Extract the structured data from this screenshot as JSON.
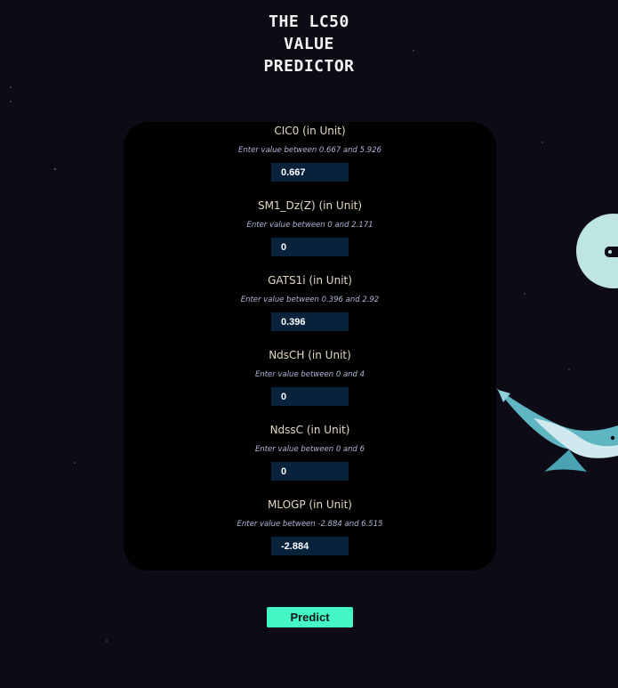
{
  "page": {
    "title_lines": [
      "THE LC50",
      "VALUE",
      "PREDICTOR"
    ]
  },
  "fields": [
    {
      "label": "CIC0 (in Unit)",
      "hint": "Enter value between 0.667 and 5.926",
      "value": "0.667"
    },
    {
      "label": "SM1_Dz(Z) (in Unit)",
      "hint": "Enter value between 0 and 2.171",
      "value": "0"
    },
    {
      "label": "GATS1i (in Unit)",
      "hint": "Enter value between 0.396 and 2.92",
      "value": "0.396"
    },
    {
      "label": "NdsCH (in Unit)",
      "hint": "Enter value between 0 and 4",
      "value": "0"
    },
    {
      "label": "NdssC (in Unit)",
      "hint": "Enter value between 0 and 6",
      "value": "0"
    },
    {
      "label": "MLOGP (in Unit)",
      "hint": "Enter value between -2.884 and 6.515",
      "value": "-2.884"
    }
  ],
  "actions": {
    "predict_label": "Predict"
  },
  "colors": {
    "background": "#0c0b16",
    "card": "#010101",
    "input_bg": "#07223a",
    "accent": "#45f7c4",
    "label_text": "#e3d7c3",
    "hint_text": "#aeb6d9"
  },
  "icons": {
    "background_art": [
      "planet-icon",
      "fish-icon"
    ]
  }
}
